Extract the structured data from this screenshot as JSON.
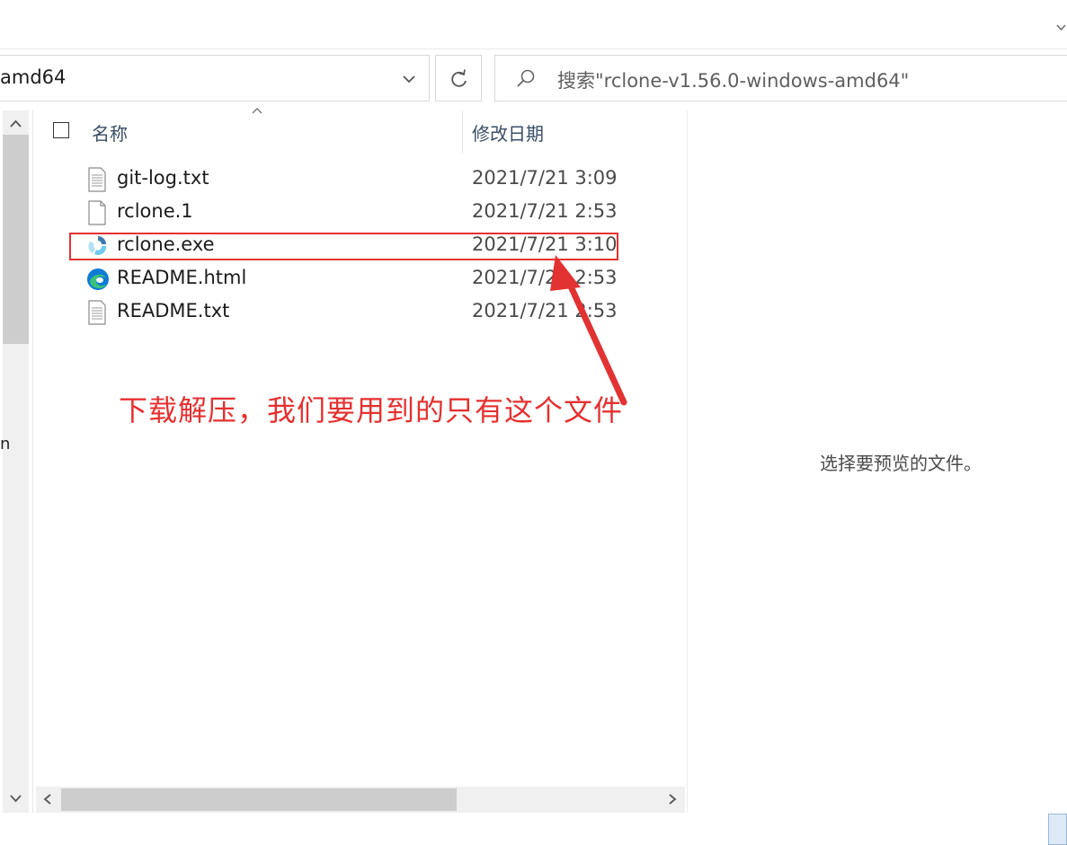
{
  "address": {
    "path_text": "amd64"
  },
  "search": {
    "placeholder": "搜索\"rclone-v1.56.0-windows-amd64\""
  },
  "columns": {
    "name": "名称",
    "date_modified": "修改日期"
  },
  "files": [
    {
      "name": "git-log.txt",
      "date": "2021/7/21 3:09",
      "icon": "text-file-icon"
    },
    {
      "name": "rclone.1",
      "date": "2021/7/21 2:53",
      "icon": "blank-file-icon"
    },
    {
      "name": "rclone.exe",
      "date": "2021/7/21 3:10",
      "icon": "rclone-app-icon"
    },
    {
      "name": "README.html",
      "date": "2021/7/21 2:53",
      "icon": "edge-browser-icon"
    },
    {
      "name": "README.txt",
      "date": "2021/7/21 2:53",
      "icon": "text-file-icon"
    }
  ],
  "annotation": {
    "text": "下载解压，我们要用到的只有这个文件",
    "color": "#e53030"
  },
  "preview": {
    "empty_text": "选择要预览的文件。"
  },
  "nav": {
    "edge_char": "n"
  },
  "colors": {
    "highlight": "#e23232",
    "header_text": "#3a4f66"
  }
}
